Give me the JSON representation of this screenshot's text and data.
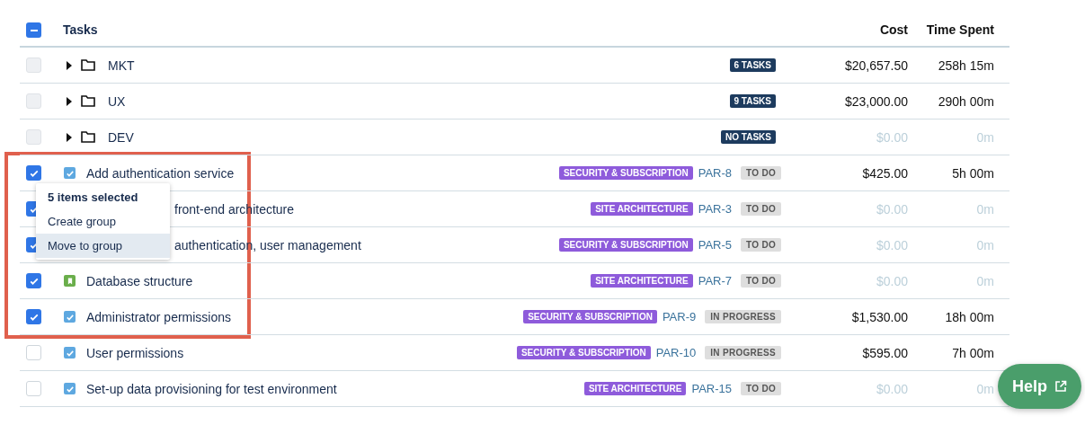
{
  "header": {
    "select_all": {
      "indeterminate": true
    },
    "columns": [
      "Tasks",
      "Cost",
      "Time Spent"
    ]
  },
  "rows": [
    {
      "kind": "group",
      "checked": false,
      "expanded": false,
      "name": "MKT",
      "badge": "6 TASKS",
      "cost": "$20,657.50",
      "time": "258h 15m",
      "muted": false
    },
    {
      "kind": "group",
      "checked": false,
      "expanded": false,
      "name": "UX",
      "badge": "9 TASKS",
      "cost": "$23,000.00",
      "time": "290h 00m",
      "muted": false
    },
    {
      "kind": "group",
      "checked": false,
      "expanded": false,
      "name": "DEV",
      "badge": "NO TASKS",
      "cost": "$0.00",
      "time": "0m",
      "muted": true
    },
    {
      "kind": "task",
      "checked": true,
      "title": "Add authentication service",
      "epic": "SECURITY & SUBSCRIPTION",
      "key": "PAR-8",
      "status": "TO DO",
      "cost": "$425.00",
      "time": "5h 00m",
      "muted": false
    },
    {
      "kind": "task",
      "checked": true,
      "covered": true,
      "title": "front-end architecture",
      "epic": "SITE ARCHITECTURE",
      "key": "PAR-3",
      "status": "TO DO",
      "cost": "$0.00",
      "time": "0m",
      "muted": true
    },
    {
      "kind": "task",
      "checked": true,
      "covered": true,
      "title": "authentication, user management",
      "epic": "SECURITY & SUBSCRIPTION",
      "key": "PAR-5",
      "status": "TO DO",
      "cost": "$0.00",
      "time": "0m",
      "muted": true
    },
    {
      "kind": "story",
      "checked": true,
      "title": "Database structure",
      "epic": "SITE ARCHITECTURE",
      "key": "PAR-7",
      "status": "TO DO",
      "cost": "$0.00",
      "time": "0m",
      "muted": true
    },
    {
      "kind": "task",
      "checked": true,
      "title": "Administrator permissions",
      "epic": "SECURITY & SUBSCRIPTION",
      "key": "PAR-9",
      "status": "IN PROGRESS",
      "cost": "$1,530.00",
      "time": "18h 00m",
      "muted": false
    },
    {
      "kind": "task",
      "checked": false,
      "title": "User permissions",
      "epic": "SECURITY & SUBSCRIPTION",
      "key": "PAR-10",
      "status": "IN PROGRESS",
      "cost": "$595.00",
      "time": "7h 00m",
      "muted": false
    },
    {
      "kind": "task",
      "checked": false,
      "title": "Set-up data provisioning for test environment",
      "epic": "SITE ARCHITECTURE",
      "key": "PAR-15",
      "status": "TO DO",
      "cost": "$0.00",
      "time": "0m",
      "muted": true
    }
  ],
  "menu": {
    "title": "5 items selected",
    "items": [
      {
        "label": "Create group",
        "selected": false
      },
      {
        "label": "Move to group",
        "selected": true
      }
    ]
  },
  "help": {
    "label": "Help"
  }
}
